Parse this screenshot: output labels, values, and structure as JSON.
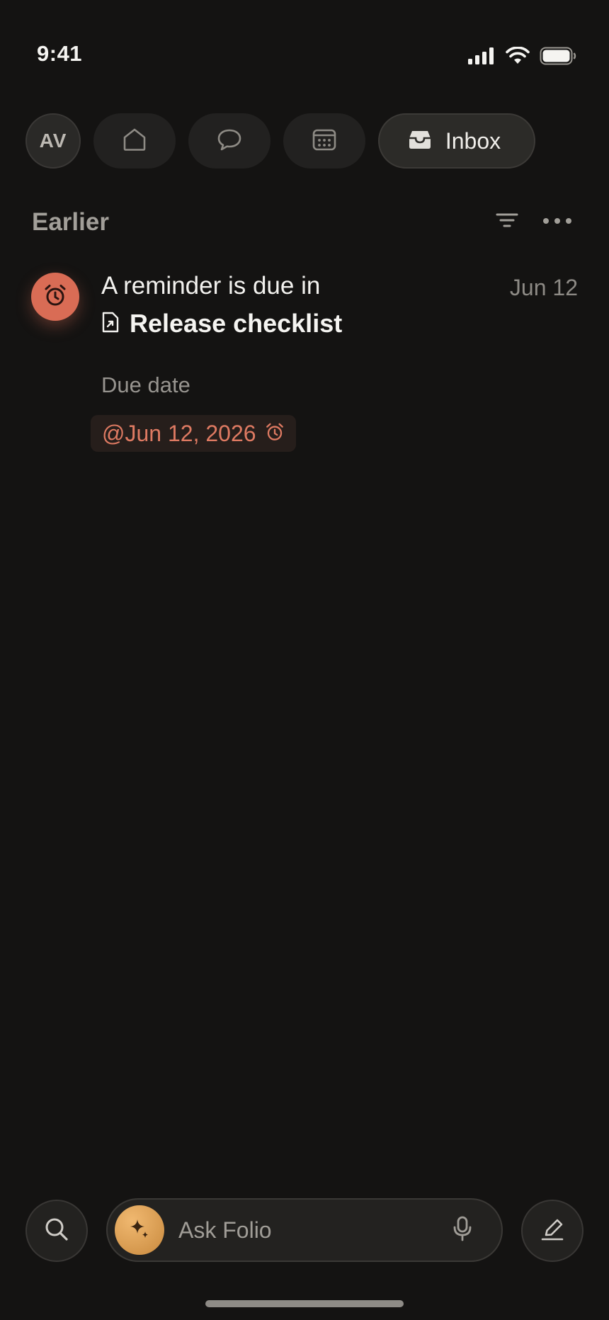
{
  "status_bar": {
    "time": "9:41",
    "icons": [
      "cellular-signal-icon",
      "wifi-icon",
      "battery-icon"
    ]
  },
  "tabs": {
    "avatar_initials": "AV",
    "items": [
      {
        "icon": "home-icon"
      },
      {
        "icon": "chat-bubble-icon"
      },
      {
        "icon": "calendar-icon"
      },
      {
        "icon": "inbox-icon",
        "label": "Inbox",
        "selected": true
      }
    ]
  },
  "section": {
    "title": "Earlier",
    "actions": [
      "filter-icon",
      "more-icon"
    ]
  },
  "notifications": [
    {
      "icon": "alarm-clock-icon",
      "text": "A reminder is due in",
      "page_icon": "page-link-icon",
      "page_title": "Release checklist",
      "date": "Jun 12",
      "property_label": "Due date",
      "property_value": "@Jun 12, 2026",
      "property_icon": "alarm-clock-icon"
    }
  ],
  "bottom_bar": {
    "ask_placeholder": "Ask Folio",
    "icons": [
      "search-icon",
      "sparkle-icon",
      "microphone-icon",
      "compose-icon"
    ]
  },
  "colors": {
    "background": "#141312",
    "accent_reminder": "#D96C55",
    "date_chip_text": "#DE7A62",
    "ask_avatar": "#D9984F"
  }
}
